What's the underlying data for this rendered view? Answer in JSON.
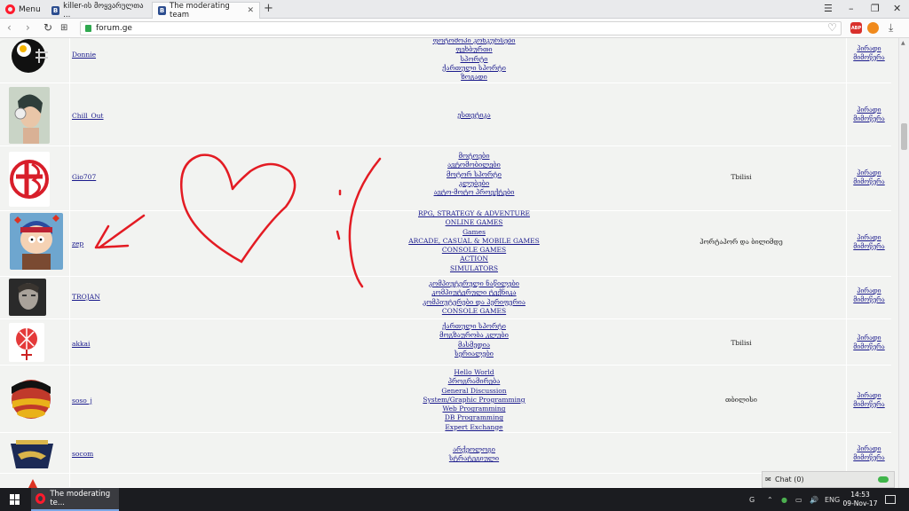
{
  "browser": {
    "menu_label": "Menu",
    "tabs": [
      {
        "label": "killer-ის მოყვარულთა ...",
        "favicon": "B"
      },
      {
        "label": "The moderating team",
        "favicon": "B"
      }
    ],
    "url": "forum.ge",
    "new_tab": "+",
    "ext_badge": "ABP",
    "ext_count": "2"
  },
  "users": [
    {
      "name": "Donnie",
      "forums": [
        "ფოტოშოპი კონკურსები",
        "ფეხბურთი",
        "სპორტი",
        "ქართული სპორტი",
        "ზოგადი"
      ],
      "location": "",
      "actions": [
        "პირადი",
        "მიმოწერა"
      ]
    },
    {
      "name": "Chill_Out",
      "forums": [
        "ესთეტიკა"
      ],
      "location": "",
      "actions": [
        "პირადი",
        "მიმოწერა"
      ]
    },
    {
      "name": "Gio707",
      "forums": [
        "მოტოები",
        "ავტომობილები",
        "მოტორ სპორტი",
        "კლუბები",
        "ავტო-მოტო პროექტები"
      ],
      "location": "Tbilisi",
      "actions": [
        "პირადი",
        "მიმოწერა"
      ]
    },
    {
      "name": "zep",
      "forums": [
        "RPG, STRATEGY & ADVENTURE",
        "ONLINE GAMES",
        "Games",
        "ARCADE, CASUAL & MOBILE GAMES",
        "CONSOLE GAMES",
        "ACTION",
        "SIMULATORS"
      ],
      "location": "პორტაპორ და ბილიმდე",
      "actions": [
        "პირადი",
        "მიმოწერა"
      ]
    },
    {
      "name": "TROJAN",
      "forums": [
        "კომპიუტერული ნაწილები",
        "კომპიუტერული ტექნიკა",
        "კომპიუტერები და პერიფერია",
        "CONSOLE GAMES"
      ],
      "location": "",
      "actions": [
        "პირადი",
        "მიმოწერა"
      ]
    },
    {
      "name": "akkai",
      "forums": [
        "ქართული სპორტი",
        "მოგზაურობა კლუბი",
        "მასმედია",
        "სერიალები"
      ],
      "location": "Tbilisi",
      "actions": [
        "პირადი",
        "მიმოწერა"
      ]
    },
    {
      "name": "soso_j",
      "forums": [
        "Hello World",
        "პროგრამირება",
        "General Discussion",
        "System/Graphic Programming",
        "Web Programming",
        "DB Programming",
        "Expert Exchange"
      ],
      "location": "თბილისი",
      "actions": [
        "პირადი",
        "მიმოწერა"
      ]
    },
    {
      "name": "socom",
      "forums": [
        "არქეოლოგი",
        "სტრატეგიული"
      ],
      "location": "",
      "actions": [
        "პირადი",
        "მიმოწერა"
      ]
    }
  ],
  "chat": {
    "label": "Chat (0)"
  },
  "taskbar": {
    "app_label": "The moderating te...",
    "lang": "ENG",
    "time": "14:53",
    "date": "09-Nov-17",
    "tray_g": "G"
  },
  "colors": {
    "accent": "#ff1b2d",
    "link": "#1a1a8c",
    "scribble": "#e31b23"
  }
}
